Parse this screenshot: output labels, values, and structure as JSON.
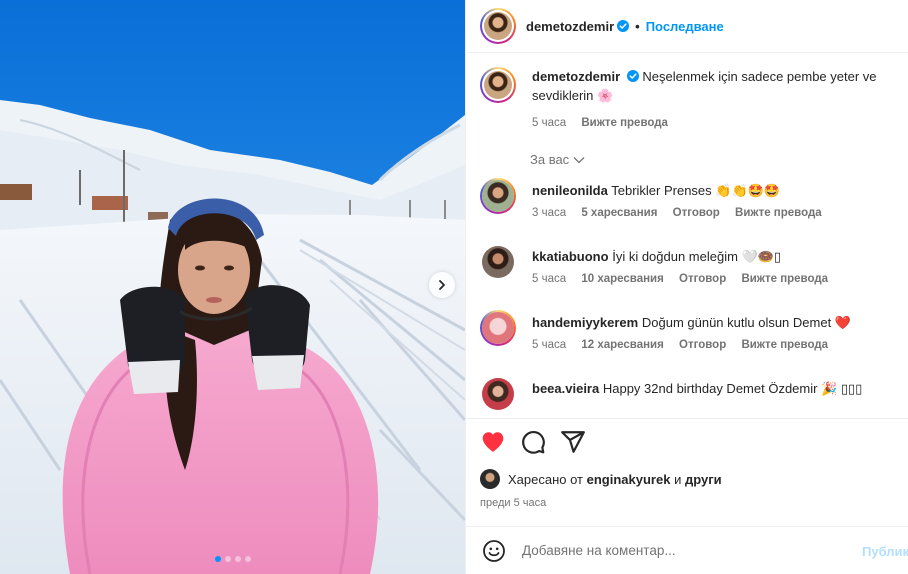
{
  "header": {
    "username": "demetozdemir",
    "verified_icon": "verified-badge-icon",
    "separator": "•",
    "follow_label": "Последване"
  },
  "caption": {
    "username": "demetozdemir",
    "text": "Neşelenmek için sadece pembe yeter ve sevdiklerin 🌸",
    "time": "5 часа",
    "translate_label": "Вижте превода"
  },
  "for_you": {
    "label": "За вас"
  },
  "comments": [
    {
      "username": "nenileonilda",
      "text": "Tebrikler Prenses 👏👏🤩🤩",
      "time": "3 часа",
      "likes": "5 харесвания",
      "reply": "Отговор",
      "translate": "Вижте превода"
    },
    {
      "username": "kkatiabuono",
      "text": "İyi ki doğdun meleğim 🤍🍩▯",
      "time": "5 часа",
      "likes": "10 харесвания",
      "reply": "Отговор",
      "translate": "Вижте превода"
    },
    {
      "username": "handemiyykerem",
      "text": "Doğum günün kutlu olsun Demet ❤️",
      "time": "5 часа",
      "likes": "12 харесвания",
      "reply": "Отговор",
      "translate": "Вижте превода"
    },
    {
      "username": "beea.vieira",
      "text": "Happy 32nd birthday Demet Özdemir 🎉 ▯▯▯"
    }
  ],
  "actions": {
    "like_icon": "heart-filled-icon",
    "comment_icon": "comment-icon",
    "share_icon": "share-icon",
    "liked_prefix": "Харесано от",
    "liked_user": "enginakyurek",
    "liked_and": "и",
    "liked_others": "други",
    "date": "преди 5 часа"
  },
  "comment_box": {
    "emoji_icon": "emoji-icon",
    "placeholder": "Добавяне на коментар...",
    "publish_label": "Публикуване"
  },
  "carousel": {
    "next_icon": "chevron-right-icon",
    "slides": 4,
    "active_slide": 1
  },
  "colors": {
    "accent": "#0095f6",
    "like": "#ff3040",
    "sweater": "#f29cc8",
    "sky": "#1a7fe0"
  }
}
